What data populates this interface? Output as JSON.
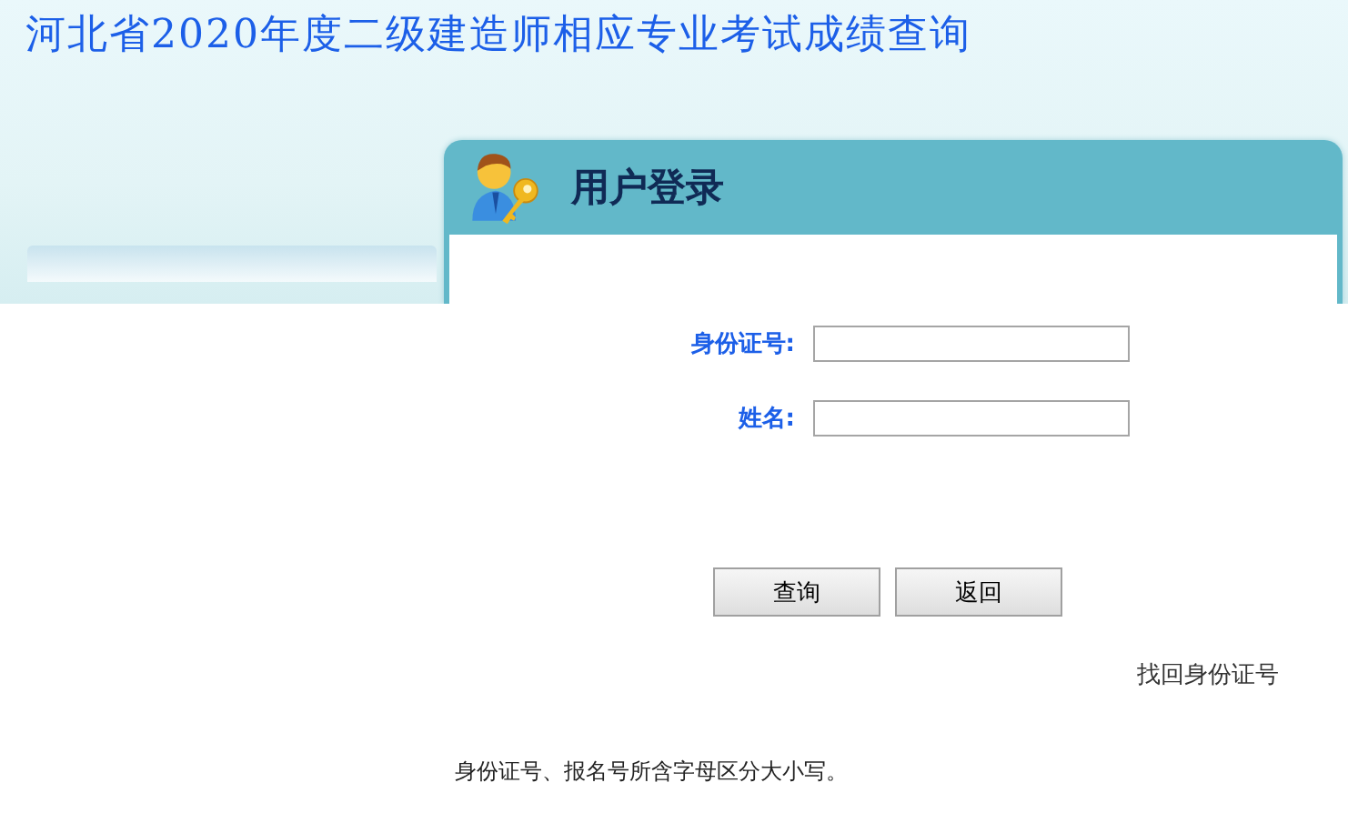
{
  "page_title": "河北省2020年度二级建造师相应专业考试成绩查询",
  "login_panel": {
    "title": "用户登录"
  },
  "fields": [
    {
      "label": "身份证号:"
    },
    {
      "label": "姓名:"
    }
  ],
  "buttons": [
    "查询",
    "返回"
  ],
  "recover_link": "找回身份证号",
  "note": "身份证号、报名号所含字母区分大小写。"
}
